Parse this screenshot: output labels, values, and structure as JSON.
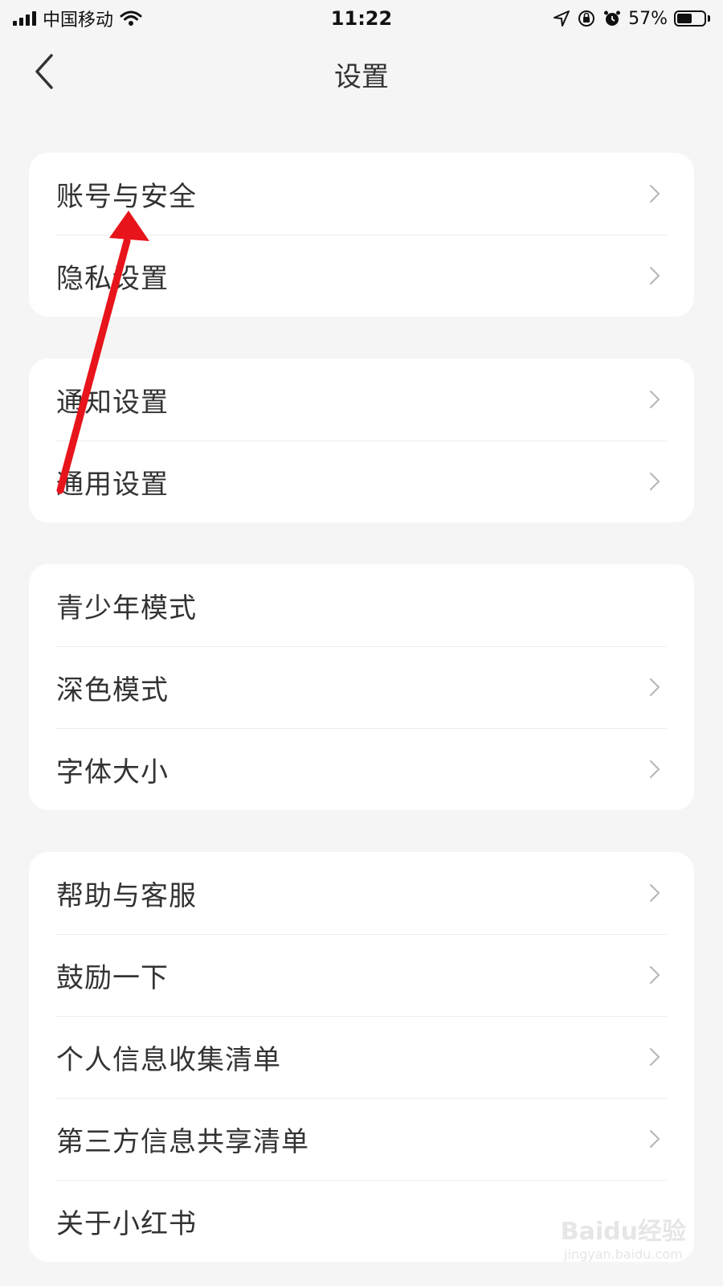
{
  "status_bar": {
    "carrier": "中国移动",
    "time": "11:22",
    "battery": "57%",
    "battery_level": 0.57
  },
  "nav": {
    "title": "设置",
    "back_icon": "chevron-left-icon"
  },
  "groups": [
    {
      "items": [
        {
          "label": "账号与安全",
          "chevron": true
        },
        {
          "label": "隐私设置",
          "chevron": true
        }
      ]
    },
    {
      "items": [
        {
          "label": "通知设置",
          "chevron": true
        },
        {
          "label": "通用设置",
          "chevron": true
        }
      ]
    },
    {
      "items": [
        {
          "label": "青少年模式",
          "chevron": false
        },
        {
          "label": "深色模式",
          "chevron": true
        },
        {
          "label": "字体大小",
          "chevron": true
        }
      ]
    },
    {
      "items": [
        {
          "label": "帮助与客服",
          "chevron": true
        },
        {
          "label": "鼓励一下",
          "chevron": true
        },
        {
          "label": "个人信息收集清单",
          "chevron": true
        },
        {
          "label": "第三方信息共享清单",
          "chevron": true
        },
        {
          "label": "关于小红书",
          "chevron": false
        }
      ]
    }
  ],
  "annotation": {
    "color": "#e8141b"
  },
  "watermark": {
    "brand": "Baidu经验",
    "url": "jingyan.baidu.com"
  }
}
